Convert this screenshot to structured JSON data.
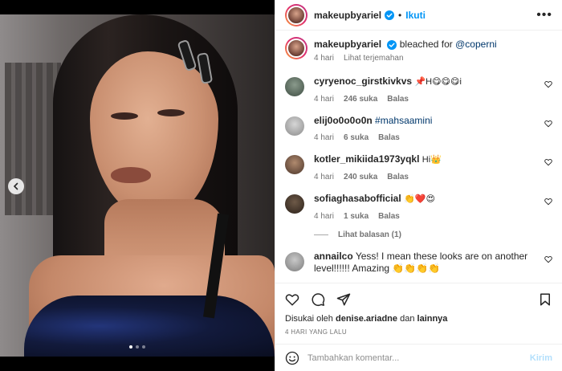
{
  "post": {
    "username": "makeupbyariel",
    "follow_label": "Ikuti",
    "separator": "•",
    "more_label": "•••",
    "carousel": {
      "total": 3,
      "active": 0
    }
  },
  "caption": {
    "username": "makeupbyariel",
    "text": "bleached for",
    "mention": "@coperni",
    "time": "4 hari",
    "translate": "Lihat terjemahan"
  },
  "comments": [
    {
      "username": "cyryenoc_girstkivkvs",
      "text": "📌H😋😋😋i",
      "time": "4 hari",
      "likes": "246 suka",
      "reply": "Balas"
    },
    {
      "username": "elij0o0o0o0n",
      "text": "#mahsaamini",
      "time": "4 hari",
      "likes": "6 suka",
      "reply": "Balas"
    },
    {
      "username": "kotler_mikiida1973yqkl",
      "text": "Hi👑",
      "time": "4 hari",
      "likes": "240 suka",
      "reply": "Balas"
    },
    {
      "username": "sofiaghasabofficial",
      "text": "👏❤️😍",
      "time": "4 hari",
      "likes": "1 suka",
      "reply": "Balas"
    },
    {
      "username": "annailco",
      "text": "Yess! I mean these looks are on another level!!!!!! Amazing 👏👏👏👏"
    }
  ],
  "view_replies": "Lihat balasan (1)",
  "likes_line": {
    "prefix": "Disukai oleh",
    "user": "denise.ariadne",
    "mid": "dan",
    "rest": "lainnya"
  },
  "date": "4 HARI YANG LALU",
  "add_comment": {
    "placeholder": "Tambahkan komentar...",
    "send": "Kirim"
  },
  "colors": {
    "accent": "#0095f6",
    "send_disabled": "#b2dffc",
    "link": "#00376b",
    "secondary_text": "#737373"
  }
}
